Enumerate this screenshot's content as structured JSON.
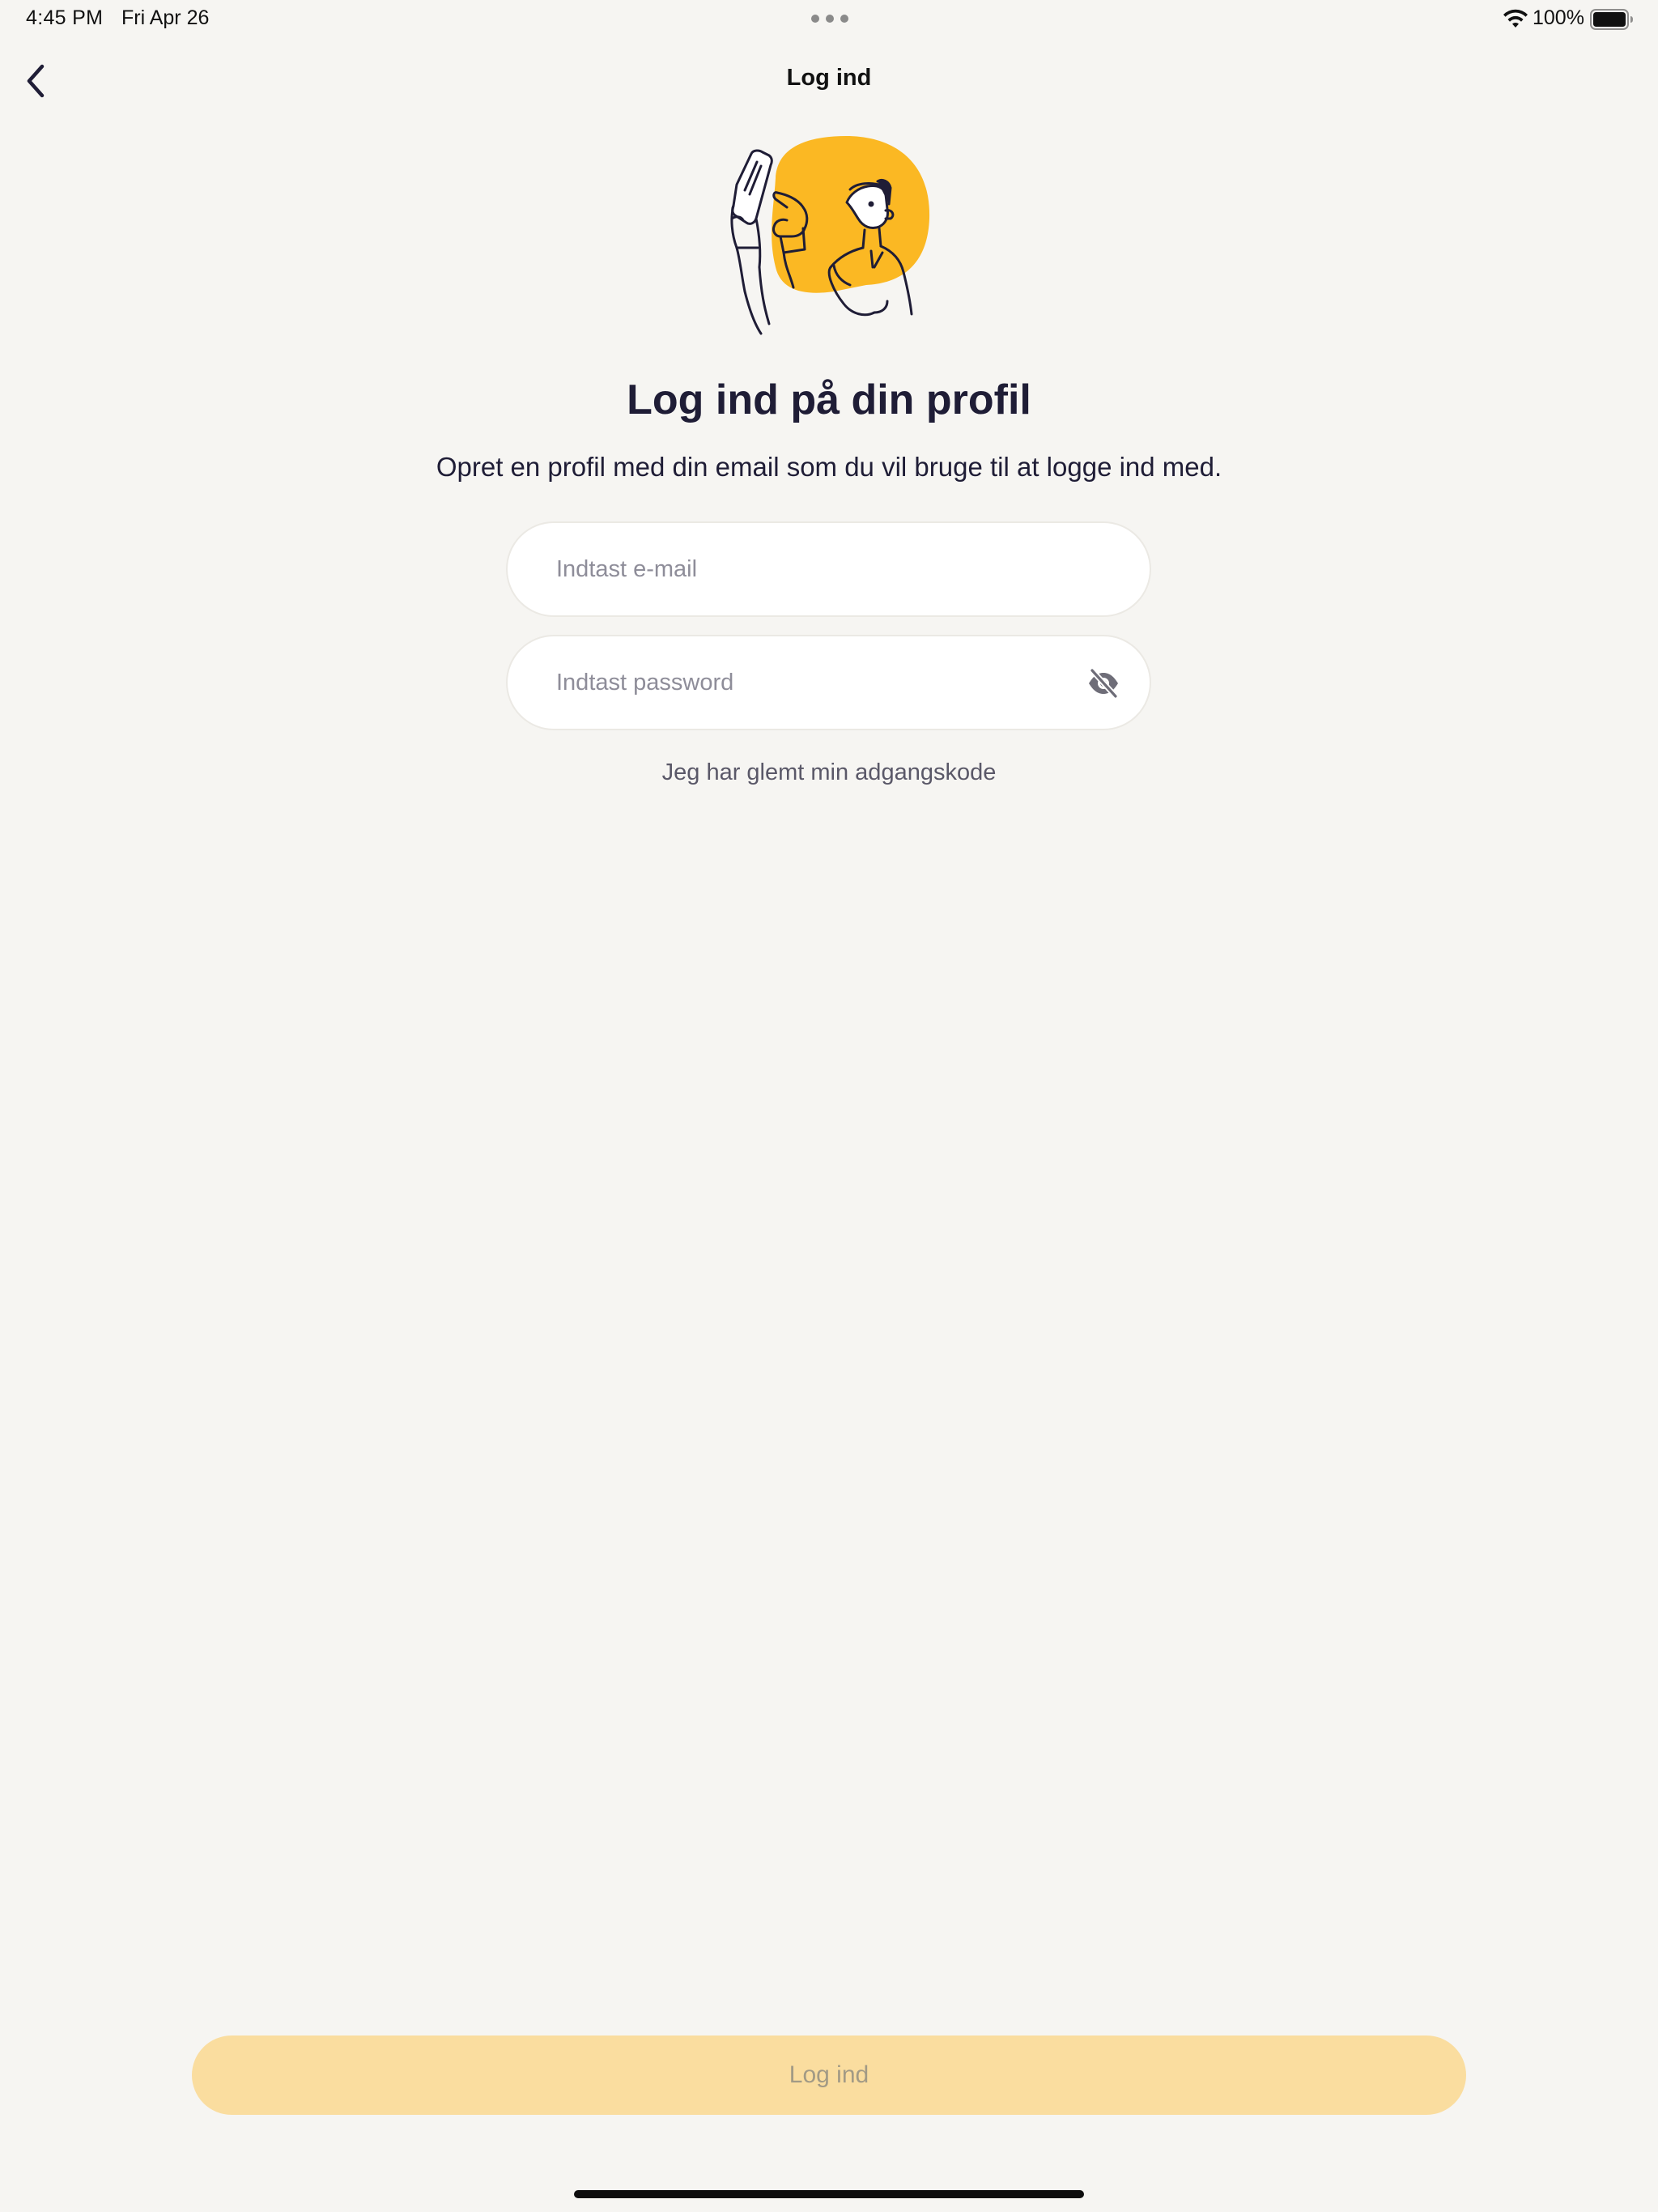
{
  "status_bar": {
    "time": "4:45 PM",
    "date": "Fri Apr 26",
    "battery_percent": "100%",
    "battery_level": 1.0,
    "icons": [
      "wifi-icon",
      "battery-icon",
      "multitask-dots-icon"
    ]
  },
  "nav": {
    "back_icon": "chevron-left-icon",
    "title": "Log ind"
  },
  "main": {
    "title": "Log ind på din profil",
    "subtitle": "Opret en profil med din email som du vil bruge til at logge ind med.",
    "email_placeholder": "Indtast e-mail",
    "email_value": "",
    "password_placeholder": "Indtast password",
    "password_value": "",
    "password_toggle_icon": "eye-off-icon",
    "forgot_password": "Jeg har glemt min adgangskode"
  },
  "footer": {
    "login_button": "Log ind"
  },
  "colors": {
    "background": "#f6f5f2",
    "accent_yellow": "#fbb823",
    "button_disabled": "#fadd9f",
    "text_dark": "#1f1d36"
  }
}
